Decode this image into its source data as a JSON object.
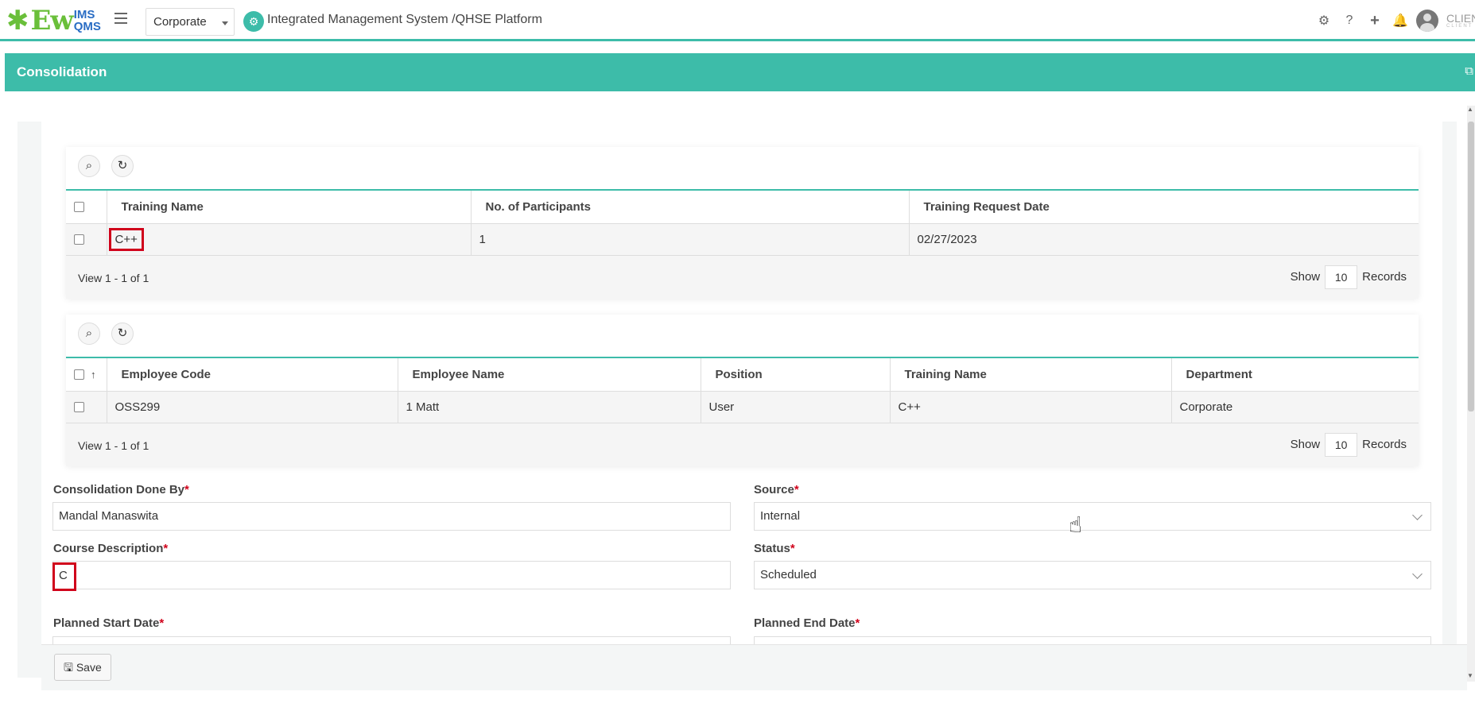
{
  "navbar": {
    "logo_ew": "Ew",
    "logo_ims": "IMS",
    "logo_qms": "QMS",
    "org_selected": "Corporate",
    "app_title": "Integrated Management System /QHSE Platform",
    "client_label": "CLIENT",
    "client_sub": "CLIENT",
    "icons": [
      "gear-icon",
      "help-icon",
      "plus-icon",
      "bell-icon",
      "avatar"
    ]
  },
  "panel": {
    "title": "Consolidation"
  },
  "training_grid": {
    "columns": [
      "Training Name",
      "No. of Participants",
      "Training Request Date"
    ],
    "rows": [
      {
        "training_name": "C++",
        "participants": "1",
        "request_date": "02/27/2023"
      }
    ],
    "footer_view": "View 1 - 1 of 1",
    "show_label": "Show",
    "page_size": "10",
    "records_label": "Records"
  },
  "employee_grid": {
    "sort_icon": "↑",
    "columns": [
      "Employee Code",
      "Employee Name",
      "Position",
      "Training Name",
      "Department"
    ],
    "rows": [
      {
        "code": "OSS299",
        "name": "1 Matt",
        "position": "User",
        "training": "C++",
        "department": "Corporate"
      }
    ],
    "footer_view": "View 1 - 1 of 1",
    "show_label": "Show",
    "page_size": "10",
    "records_label": "Records"
  },
  "form": {
    "consolidation_done_by_label": "Consolidation Done By",
    "consolidation_done_by_value": "Mandal Manaswita",
    "source_label": "Source",
    "source_value": "Internal",
    "course_description_label": "Course Description",
    "course_description_value": "C",
    "status_label": "Status",
    "status_value": "Scheduled",
    "planned_start_label": "Planned Start Date",
    "planned_end_label": "Planned End Date",
    "required_mark": "*"
  },
  "actions": {
    "save_label": "Save"
  },
  "colors": {
    "accent": "#3dbca9",
    "required": "#d0021b",
    "highlight_box": "#d0021b"
  }
}
